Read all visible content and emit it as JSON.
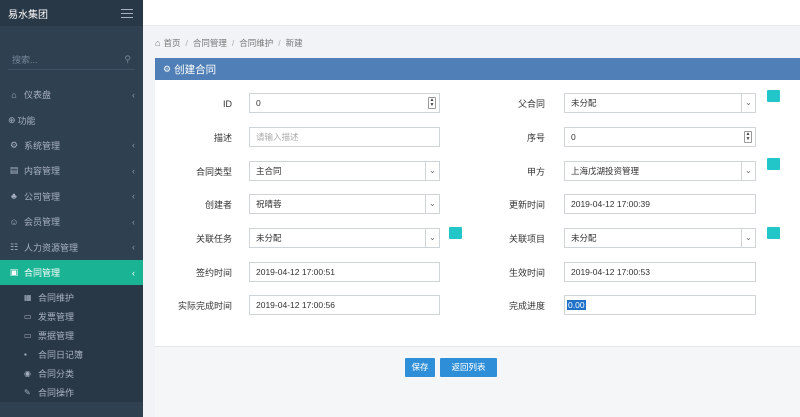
{
  "sidebar": {
    "brand": "易水集团",
    "search_placeholder": "搜索...",
    "dashboard": "仪表盘",
    "section_label": "功能",
    "items": [
      {
        "label": "系统管理"
      },
      {
        "label": "内容管理"
      },
      {
        "label": "公司管理"
      },
      {
        "label": "会员管理"
      },
      {
        "label": "人力资源管理"
      }
    ],
    "active_item": "合同管理",
    "subitems": [
      {
        "label": "合同维护"
      },
      {
        "label": "发票管理"
      },
      {
        "label": "票据管理"
      },
      {
        "label": "合同日记簿"
      },
      {
        "label": "合同分类"
      },
      {
        "label": "合同操作"
      }
    ]
  },
  "breadcrumb": [
    "首页",
    "合同管理",
    "合同维护",
    "新建"
  ],
  "panel": {
    "title": "创建合同"
  },
  "form": {
    "id_label": "ID",
    "id_value": "0",
    "parent_label": "父合同",
    "parent_value": "未分配",
    "desc_label": "描述",
    "desc_placeholder": "请输入描述",
    "seq_label": "序号",
    "seq_value": "0",
    "type_label": "合同类型",
    "type_value": "主合同",
    "partya_label": "甲方",
    "partya_value": "上海戊湖投资管理",
    "creator_label": "创建者",
    "creator_value": "祝晴蓉",
    "updated_label": "更新时间",
    "updated_value": "2019-04-12 17:00:39",
    "task_label": "关联任务",
    "task_value": "未分配",
    "project_label": "关联项目",
    "project_value": "未分配",
    "signed_label": "签约时间",
    "signed_value": "2019-04-12 17:00:51",
    "effective_label": "生效时间",
    "effective_value": "2019-04-12 17:00:53",
    "finished_label": "实际完成时间",
    "finished_value": "2019-04-12 17:00:56",
    "progress_label": "完成进度",
    "progress_value": "0.00"
  },
  "buttons": {
    "save": "保存",
    "back": "返回列表"
  },
  "colors": {
    "sidebar_bg": "#2f4050",
    "active": "#1ab394",
    "panel_header": "#4f7fb6",
    "button": "#2e8fd8",
    "plus": "#23c6c8"
  }
}
